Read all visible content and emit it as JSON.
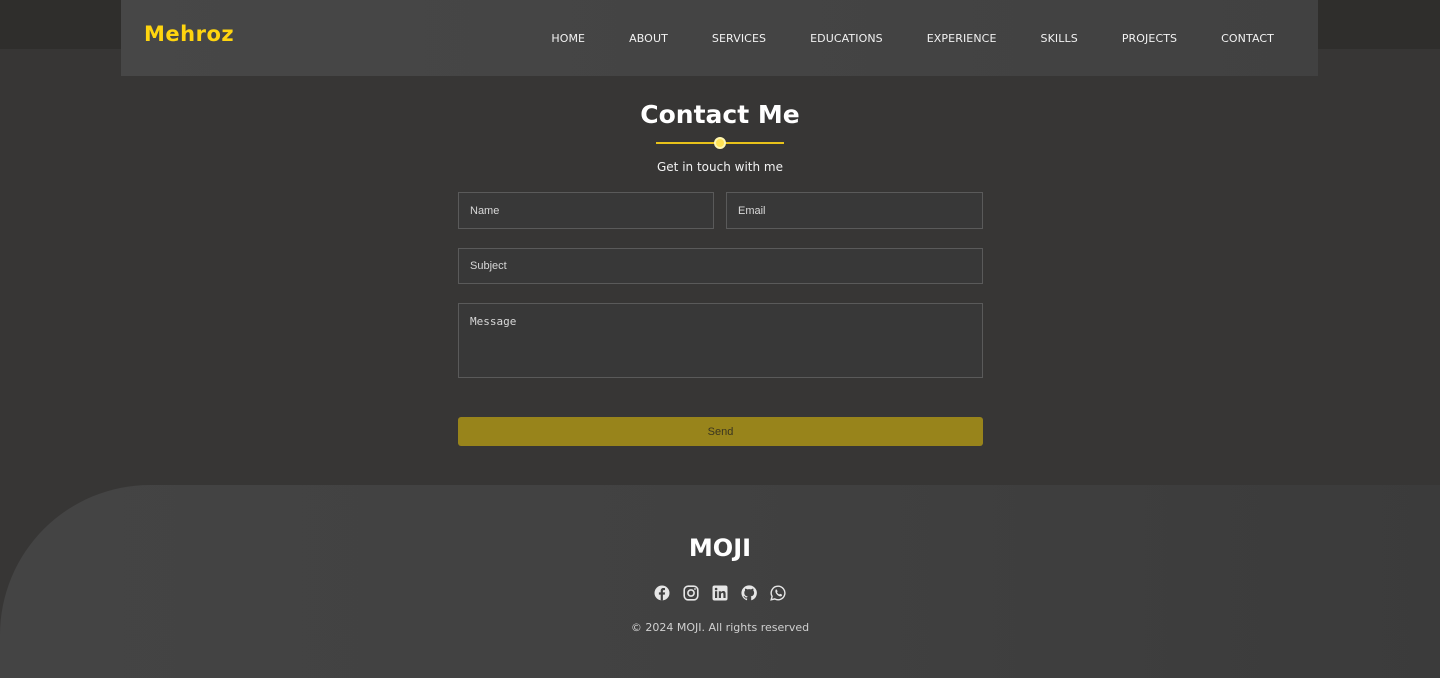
{
  "header": {
    "logo": "Mehroz",
    "nav": [
      "HOME",
      "ABOUT",
      "SERVICES",
      "EDUCATIONS",
      "EXPERIENCE",
      "SKILLS",
      "PROJECTS",
      "CONTACT"
    ]
  },
  "contact": {
    "title": "Contact Me",
    "subtitle": "Get in touch with me",
    "name_placeholder": "Name",
    "email_placeholder": "Email",
    "subject_placeholder": "Subject",
    "message_placeholder": "Message",
    "send_label": "Send"
  },
  "footer": {
    "brand": "MOJI",
    "socials": [
      "facebook-icon",
      "instagram-icon",
      "linkedin-icon",
      "github-icon",
      "whatsapp-icon"
    ],
    "copyright": "© 2024 MOJI. All rights reserved"
  },
  "colors": {
    "accent": "#ffd50f",
    "button": "#98841b",
    "background": "#373635"
  }
}
